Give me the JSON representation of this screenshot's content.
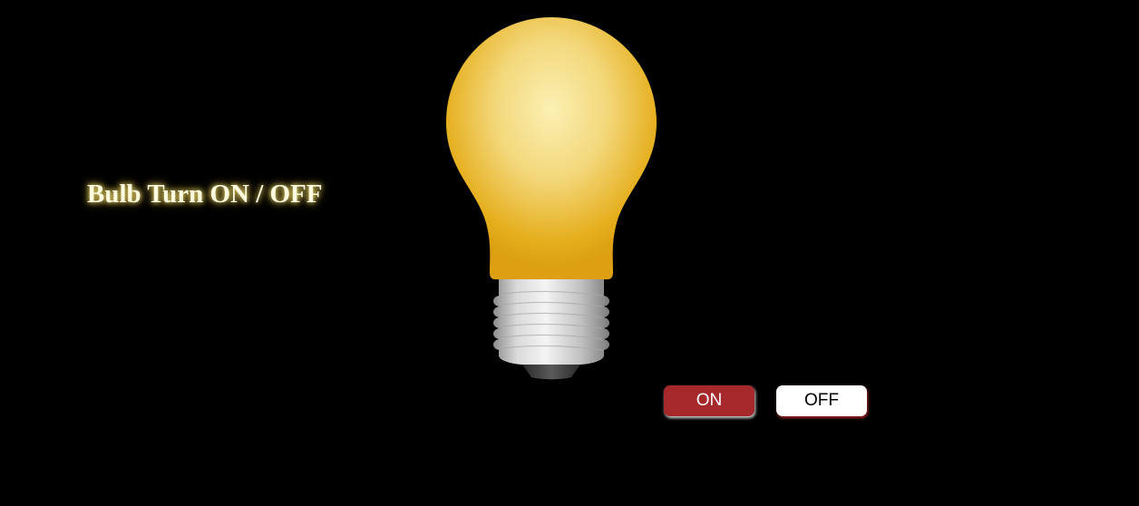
{
  "header": {
    "title": "Bulb Turn ON / OFF"
  },
  "bulb": {
    "icon": "lightbulb-icon",
    "state": "on",
    "glass_color": "#f0c23a",
    "base_color": "#cfcfcf"
  },
  "controls": {
    "on_label": "ON",
    "off_label": "OFF",
    "on_color": "#a5282a",
    "off_color": "#ffffff"
  }
}
